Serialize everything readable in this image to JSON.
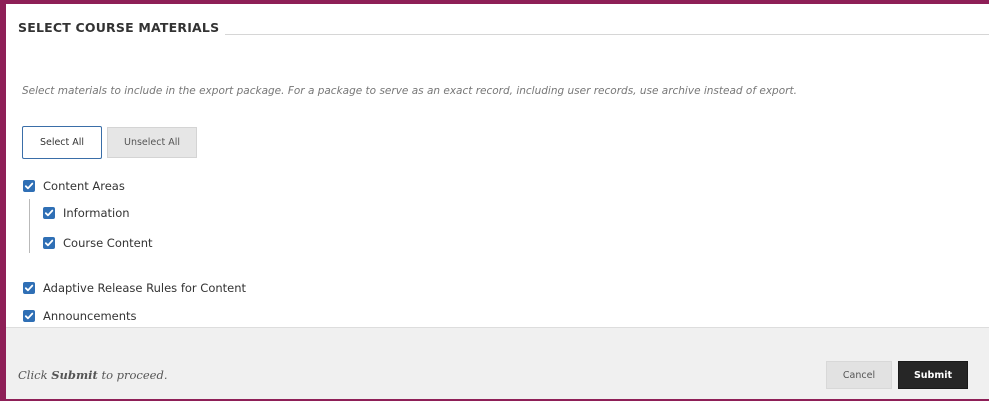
{
  "section": {
    "title": "SELECT COURSE MATERIALS",
    "instructions": "Select materials to include in the export package. For a package to serve as an exact record, including user records, use archive instead of export."
  },
  "buttons": {
    "select_all": "Select All",
    "unselect_all": "Unselect All"
  },
  "materials": {
    "content_areas": {
      "label": "Content Areas",
      "checked": true
    },
    "children": [
      {
        "label": "Information",
        "checked": true
      },
      {
        "label": "Course Content",
        "checked": true
      }
    ],
    "adaptive_release": {
      "label": "Adaptive Release Rules for Content",
      "checked": true
    },
    "announcements": {
      "label": "Announcements",
      "checked": true
    }
  },
  "footer": {
    "prefix": "Click ",
    "keyword": "Submit",
    "suffix": " to proceed.",
    "cancel_label": "Cancel",
    "submit_label": "Submit"
  },
  "colors": {
    "frame_border": "#8e1f57",
    "checkbox": "#2f6fb5",
    "submit_bg": "#262626"
  }
}
